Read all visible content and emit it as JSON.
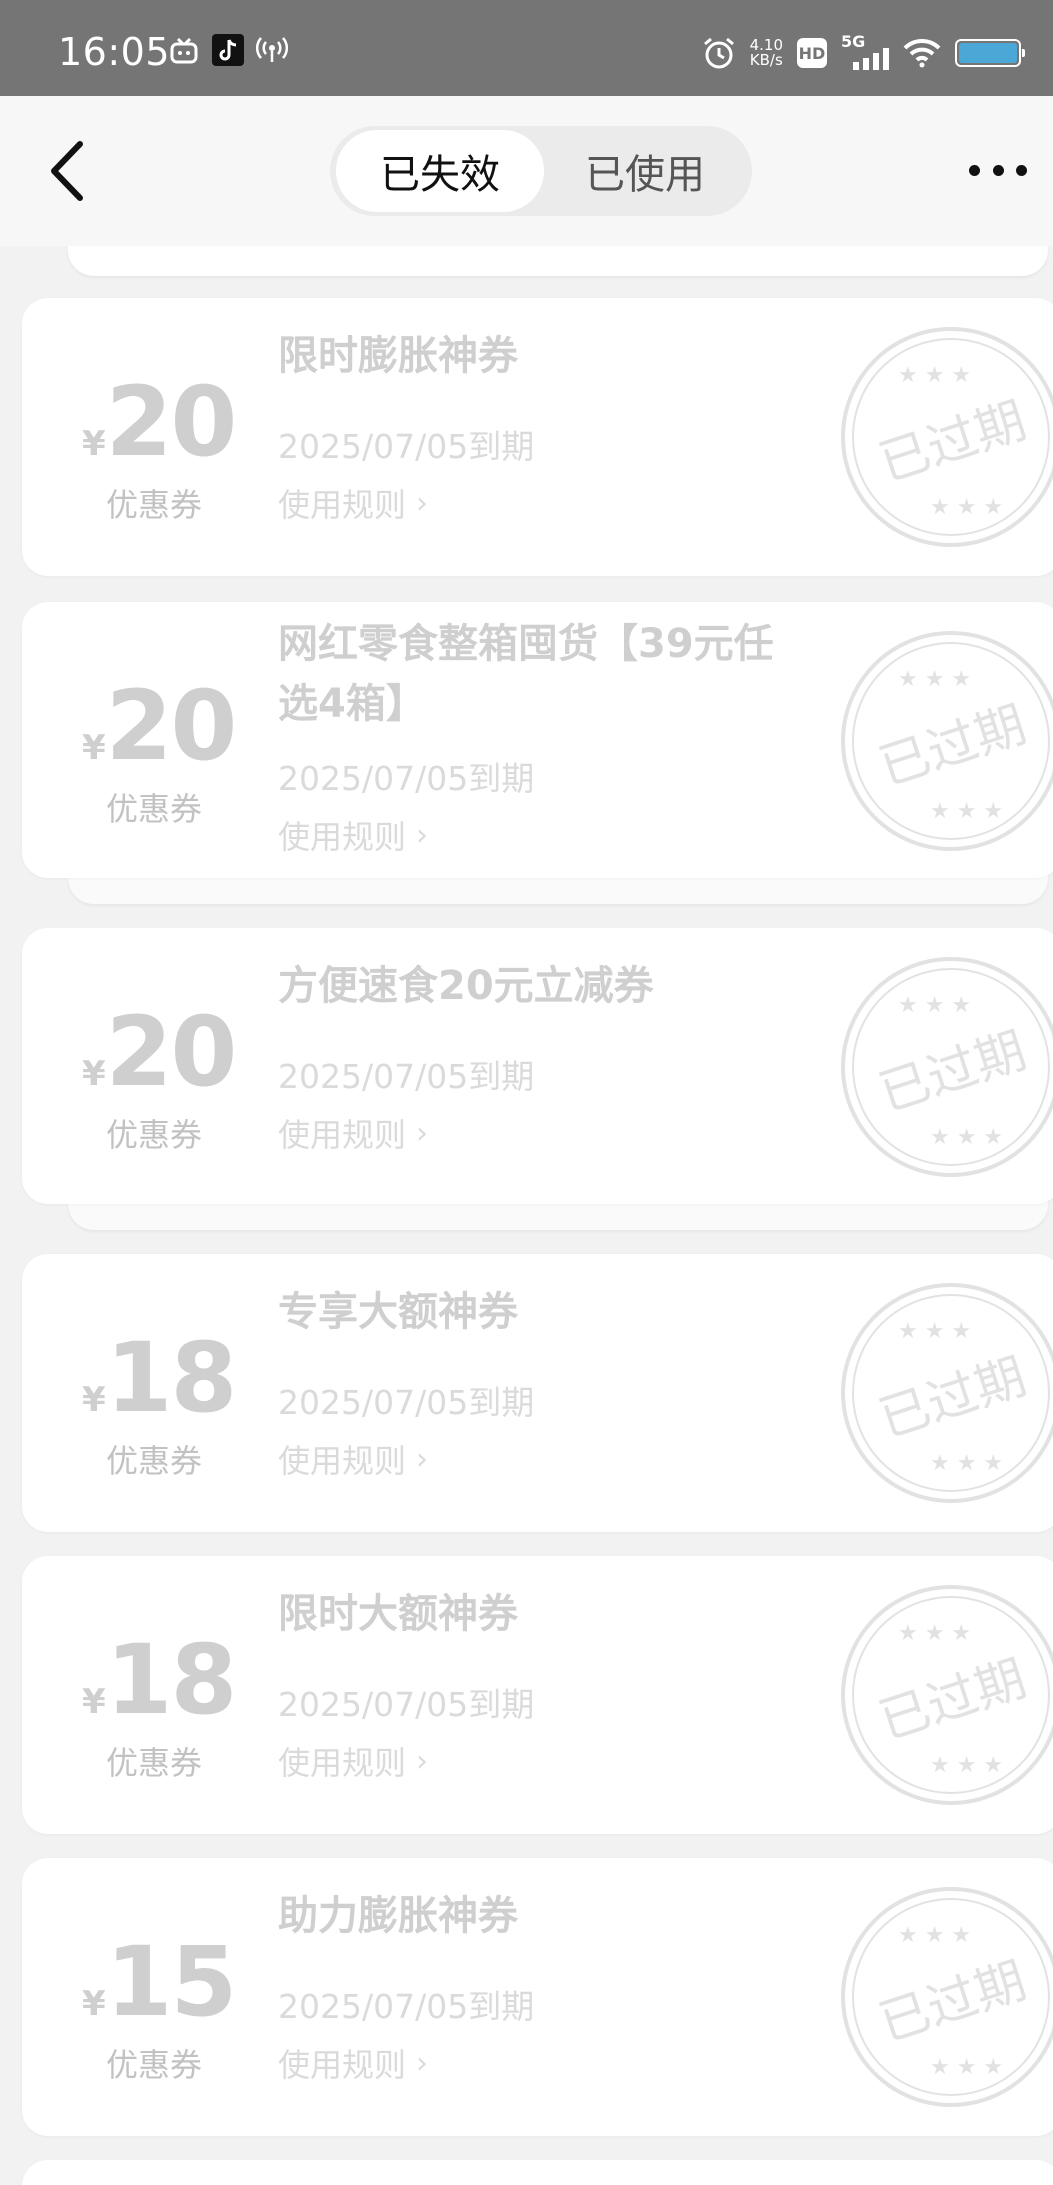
{
  "status_bar": {
    "time": "16:05",
    "speed_value": "4.10",
    "speed_unit": "KB/s",
    "hd": "HD",
    "network": "5G"
  },
  "header": {
    "tabs": [
      {
        "label": "已失效",
        "active": true
      },
      {
        "label": "已使用",
        "active": false
      }
    ]
  },
  "coupons": [
    {
      "currency": "¥",
      "amount": "20",
      "type": "优惠券",
      "title": "限时膨胀神券",
      "expiry": "2025/07/05到期",
      "rules": "使用规则",
      "stamp": "已过期"
    },
    {
      "currency": "¥",
      "amount": "20",
      "type": "优惠券",
      "title": "网红零食整箱囤货【39元任选4箱】",
      "expiry": "2025/07/05到期",
      "rules": "使用规则",
      "stamp": "已过期"
    },
    {
      "currency": "¥",
      "amount": "20",
      "type": "优惠券",
      "title": "方便速食20元立减券",
      "expiry": "2025/07/05到期",
      "rules": "使用规则",
      "stamp": "已过期"
    },
    {
      "currency": "¥",
      "amount": "18",
      "type": "优惠券",
      "title": "专享大额神券",
      "expiry": "2025/07/05到期",
      "rules": "使用规则",
      "stamp": "已过期"
    },
    {
      "currency": "¥",
      "amount": "18",
      "type": "优惠券",
      "title": "限时大额神券",
      "expiry": "2025/07/05到期",
      "rules": "使用规则",
      "stamp": "已过期"
    },
    {
      "currency": "¥",
      "amount": "15",
      "type": "优惠券",
      "title": "助力膨胀神券",
      "expiry": "2025/07/05到期",
      "rules": "使用规则",
      "stamp": "已过期"
    }
  ],
  "colors": {
    "status_bar_bg": "#757575",
    "page_bg": "#f2f2f2",
    "expired_text": "#cfcfcf"
  }
}
